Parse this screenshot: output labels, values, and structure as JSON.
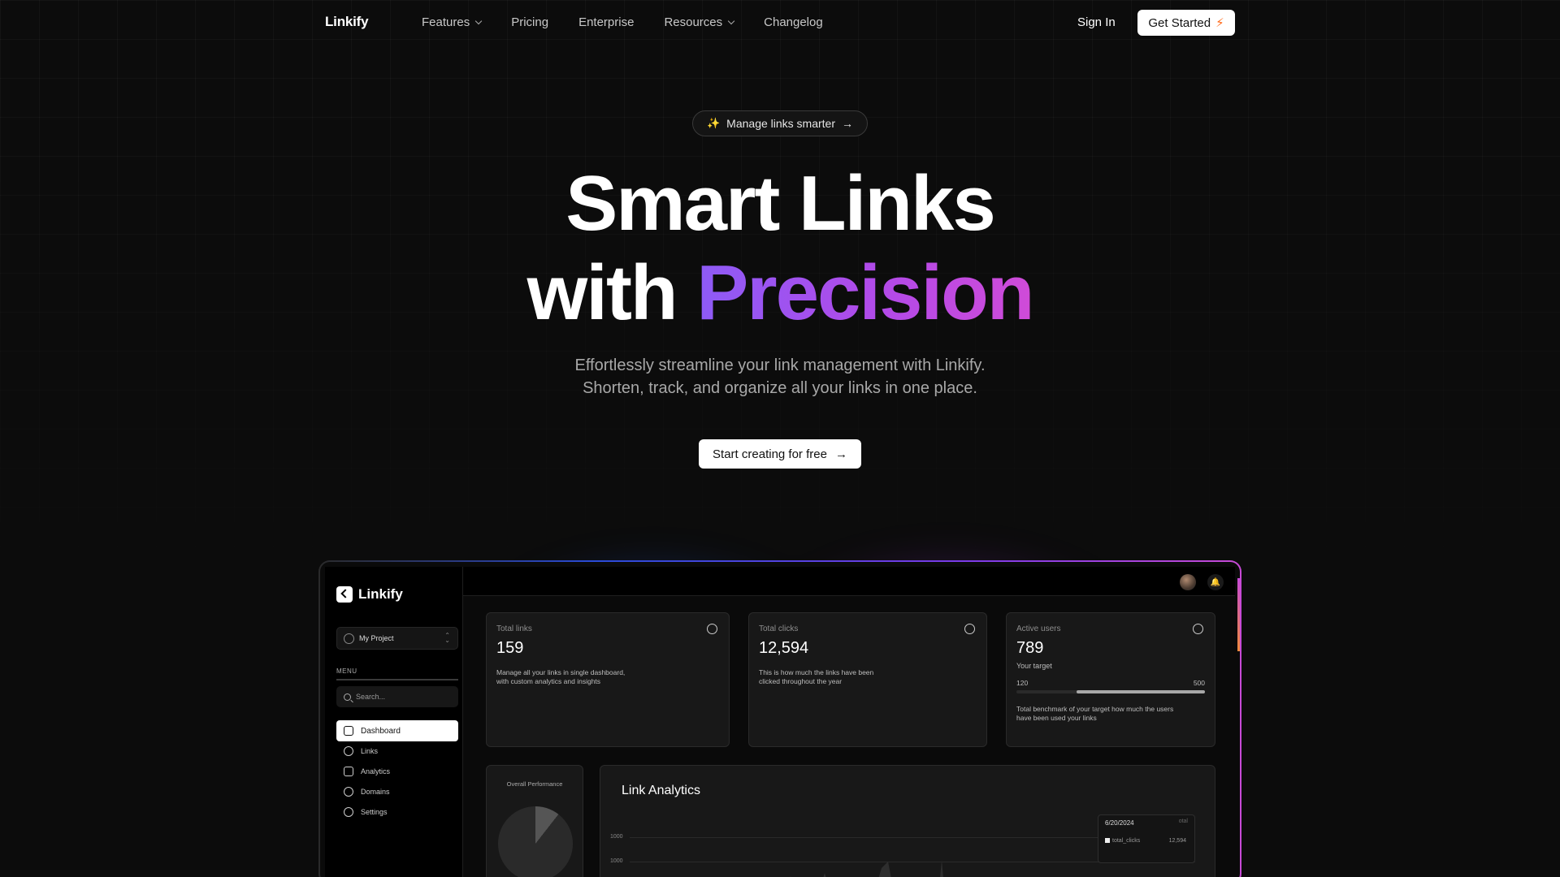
{
  "nav": {
    "logo": "Linkify",
    "links": [
      {
        "label": "Features",
        "dropdown": true
      },
      {
        "label": "Pricing",
        "dropdown": false
      },
      {
        "label": "Enterprise",
        "dropdown": false
      },
      {
        "label": "Resources",
        "dropdown": true
      },
      {
        "label": "Changelog",
        "dropdown": false
      }
    ],
    "sign_in": "Sign In",
    "get_started": "Get Started"
  },
  "hero": {
    "pill": "Manage links smarter",
    "title_line1": "Smart Links",
    "title_line2_plain": "with",
    "title_line2_accent": "Precision",
    "subtitle_line1": "Effortlessly streamline your link management with Linkify.",
    "subtitle_line2": "Shorten, track, and organize all your links in one place.",
    "cta": "Start creating for free",
    "accent_gradient": [
      "#8d5bf6",
      "#d04bd8"
    ]
  },
  "dashboard": {
    "sidebar": {
      "logo": "Linkify",
      "project": "My Project",
      "menu_label": "MENU",
      "search_placeholder": "Search...",
      "items": [
        {
          "label": "Dashboard",
          "icon": "grid-icon",
          "active": true
        },
        {
          "label": "Links",
          "icon": "link-icon",
          "active": false
        },
        {
          "label": "Analytics",
          "icon": "chart-icon",
          "active": false
        },
        {
          "label": "Domains",
          "icon": "globe-icon",
          "active": false
        },
        {
          "label": "Settings",
          "icon": "gear-icon",
          "active": false
        }
      ]
    },
    "cards": {
      "total_links": {
        "title": "Total links",
        "value": "159",
        "desc_line1": "Manage all your links in single dashboard,",
        "desc_line2": "with custom analytics and insights"
      },
      "total_clicks": {
        "title": "Total clicks",
        "value": "12,594",
        "desc_line1": "This is how much the links have been",
        "desc_line2": "clicked throughout the year"
      },
      "active_users": {
        "title": "Active users",
        "value": "789",
        "target_label": "Your target",
        "range_min": "120",
        "range_max": "500",
        "progress_start_fraction": 0.32,
        "progress_end_fraction": 1.0,
        "desc_line1": "Total benchmark of your target how much the users",
        "desc_line2": "have been used your links"
      }
    },
    "performance": {
      "title": "Overall Performance"
    },
    "link_analytics": {
      "title": "Link Analytics",
      "ticks": [
        "1000",
        "1000"
      ],
      "tooltip": {
        "date": "6/20/2024",
        "series": "total_clicks",
        "value": "12,594",
        "header": "otal"
      }
    }
  }
}
